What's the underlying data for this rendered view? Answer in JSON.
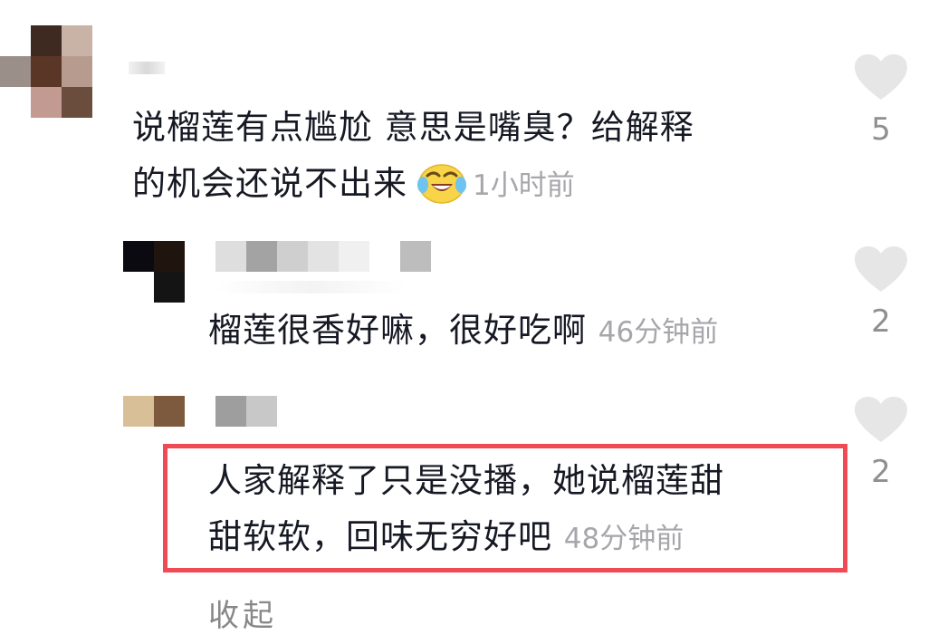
{
  "comments": [
    {
      "text_line1": "说榴莲有点尴尬 意思是嘴臭？给解释",
      "text_line2": "的机会还说不出来",
      "emoji": "crying-laughing-face-icon",
      "time": "1小时前",
      "likes": "5"
    },
    {
      "text": "榴莲很香好嘛，很好吃啊",
      "time": "46分钟前",
      "likes": "2"
    },
    {
      "text_line1": "人家解释了只是没播，她说榴莲甜",
      "text_line2": "甜软软，回味无穷好吧",
      "time": "48分钟前",
      "likes": "2"
    }
  ],
  "collapse_label": "收起",
  "colors": {
    "highlight_border": "#f04a55",
    "timestamp": "#a6a6ab",
    "heart": "#e6e6e6"
  }
}
